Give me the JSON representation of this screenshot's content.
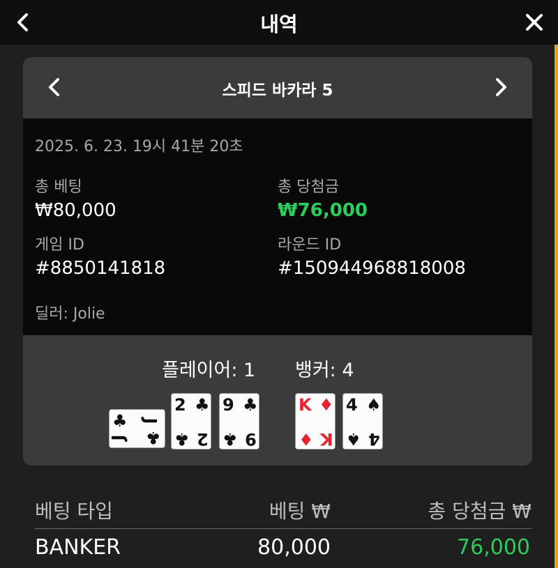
{
  "header": {
    "title": "내역"
  },
  "game": {
    "title": "스피드 바카라 5"
  },
  "info": {
    "datetime": "2025. 6. 23. 19시 41분 20초",
    "total_bet_label": "총 베팅",
    "total_bet_value": "₩80,000",
    "total_win_label": "총 당첨금",
    "total_win_value": "₩76,000",
    "game_id_label": "게임 ID",
    "game_id_value": "#8850141818",
    "round_id_label": "라운드 ID",
    "round_id_value": "#150944968818008",
    "dealer": "딜러: Jolie"
  },
  "result": {
    "player_score": "플레이어: 1",
    "banker_score": "뱅커: 4",
    "player_cards": [
      {
        "rank": "J",
        "suit": "♣",
        "color": "black",
        "orientation": "sideways"
      },
      {
        "rank": "2",
        "suit": "♣",
        "color": "black"
      },
      {
        "rank": "9",
        "suit": "♣",
        "color": "black"
      }
    ],
    "banker_cards": [
      {
        "rank": "K",
        "suit": "♦",
        "color": "red"
      },
      {
        "rank": "4",
        "suit": "♠",
        "color": "black"
      }
    ]
  },
  "bets": {
    "columns": [
      "베팅 타입",
      "베팅 ₩",
      "총 당첨금 ₩"
    ],
    "rows": [
      {
        "type": "BANKER",
        "bet": "80,000",
        "win": "76,000"
      }
    ]
  },
  "colors": {
    "win_green": "#2ecc5a",
    "accent_orange": "#f2a122",
    "card_red": "#e8232f"
  }
}
